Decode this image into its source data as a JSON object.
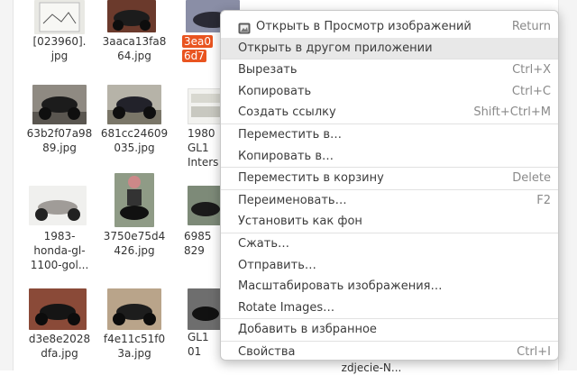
{
  "files": [
    {
      "name": "[023960].jpg"
    },
    {
      "name": "3aaca13fa864.jpg"
    },
    {
      "name": "3ea0…6d7…"
    },
    {
      "name": "63b2f07a9889.jpg"
    },
    {
      "name": "681cc24609035.jpg"
    },
    {
      "name": "1980 GL1 Inters"
    },
    {
      "name": "1983-honda-gl-1100-gol..."
    },
    {
      "name": "3750e75d4426.jpg"
    },
    {
      "name": "6985 829…"
    },
    {
      "name": "d3e8e2028dfa.jpg"
    },
    {
      "name": "f4e11c51f03a.jpg"
    },
    {
      "name": "GL1 01…"
    },
    {
      "name": "zdjecie-N…"
    }
  ],
  "labels": {
    "f0a": "[023960].",
    "f0b": "jpg",
    "f1a": "3aaca13fa8",
    "f1b": "64.jpg",
    "f2a": "3ea0",
    "f2b": "6d7",
    "f3a": "63b2f07a98",
    "f3b": "89.jpg",
    "f4a": "681cc24609",
    "f4b": "035.jpg",
    "f5a": "1980",
    "f5b": "GL1",
    "f5c": "Inters",
    "f6a": "1983-",
    "f6b": "honda-gl-",
    "f6c": "1100-gol...",
    "f7a": "3750e75d4",
    "f7b": "426.jpg",
    "f8a": "6985",
    "f8b": "829",
    "f9a": "d3e8e2028",
    "f9b": "dfa.jpg",
    "f10a": "f4e11c51f0",
    "f10b": "3a.jpg",
    "f11a": "GL1",
    "f11b": "01",
    "f12a": "zdjecie-N..."
  },
  "menu": {
    "items": [
      {
        "label": "Открыть в Просмотр изображений",
        "shortcut": "Return",
        "icon": "image-viewer-icon"
      },
      {
        "label": "Открыть в другом приложении",
        "shortcut": "",
        "highlighted": true
      },
      {
        "label": "Вырезать",
        "shortcut": "Ctrl+X"
      },
      {
        "label": "Копировать",
        "shortcut": "Ctrl+C"
      },
      {
        "label": "Создать ссылку",
        "shortcut": "Shift+Ctrl+M"
      },
      {
        "label": "Переместить в…",
        "shortcut": ""
      },
      {
        "label": "Копировать в…",
        "shortcut": ""
      },
      {
        "label": "Переместить в корзину",
        "shortcut": "Delete"
      },
      {
        "label": "Переименовать…",
        "shortcut": "F2"
      },
      {
        "label": "Установить как фон",
        "shortcut": ""
      },
      {
        "label": "Сжать…",
        "shortcut": ""
      },
      {
        "label": "Отправить…",
        "shortcut": ""
      },
      {
        "label": "Масштабировать изображения…",
        "shortcut": ""
      },
      {
        "label": "Rotate Images…",
        "shortcut": ""
      },
      {
        "label": "Добавить в избранное",
        "shortcut": ""
      },
      {
        "label": "Свойства",
        "shortcut": "Ctrl+I"
      }
    ]
  },
  "colors": {
    "accent": "#e95420",
    "menu_highlight": "#e8e8e8"
  }
}
